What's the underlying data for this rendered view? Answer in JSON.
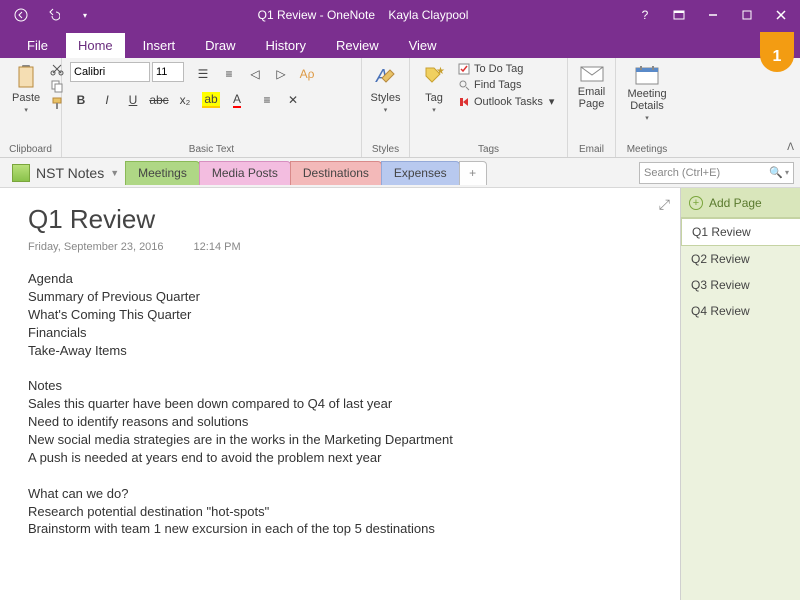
{
  "titlebar": {
    "title": "Q1 Review - OneNote",
    "user": "Kayla Claypool"
  },
  "menu": {
    "file": "File",
    "home": "Home",
    "insert": "Insert",
    "draw": "Draw",
    "history": "History",
    "review": "Review",
    "view": "View"
  },
  "ribbon": {
    "clipboard": "Clipboard",
    "paste": "Paste",
    "basictext": "Basic Text",
    "font": "Calibri",
    "size": "11",
    "styles": "Styles",
    "styles_btn": "Styles",
    "tags": "Tags",
    "tag_btn": "Tag",
    "todo": "To Do Tag",
    "find": "Find Tags",
    "outlook": "Outlook Tasks",
    "email_grp": "Email",
    "email_btn": "Email Page",
    "meetings_grp": "Meetings",
    "meeting_btn": "Meeting Details"
  },
  "notebook": {
    "name": "NST Notes"
  },
  "sections": {
    "s0": "Meetings",
    "s1": "Media Posts",
    "s2": "Destinations",
    "s3": "Expenses"
  },
  "search": {
    "placeholder": "Search (Ctrl+E)"
  },
  "pagepanel": {
    "add": "Add Page",
    "p0": "Q1 Review",
    "p1": "Q2 Review",
    "p2": "Q3 Review",
    "p3": "Q4 Review"
  },
  "page": {
    "title": "Q1 Review",
    "date": "Friday, September 23, 2016",
    "time": "12:14 PM",
    "l0": "Agenda",
    "l1": "Summary of Previous Quarter",
    "l2": "What's Coming This Quarter",
    "l3": "Financials",
    "l4": "Take-Away Items",
    "l5": "Notes",
    "l6": "Sales this quarter have been down compared to Q4 of last year",
    "l7": "Need to identify reasons and solutions",
    "l8": "New social media strategies are in the works in the Marketing Department",
    "l9": "A push is needed at years end to avoid the problem next year",
    "l10": "What can we do?",
    "l11": "Research potential destination \"hot-spots\"",
    "l12": "Brainstorm with team 1 new excursion in each of the top 5 destinations"
  },
  "callout": "1"
}
